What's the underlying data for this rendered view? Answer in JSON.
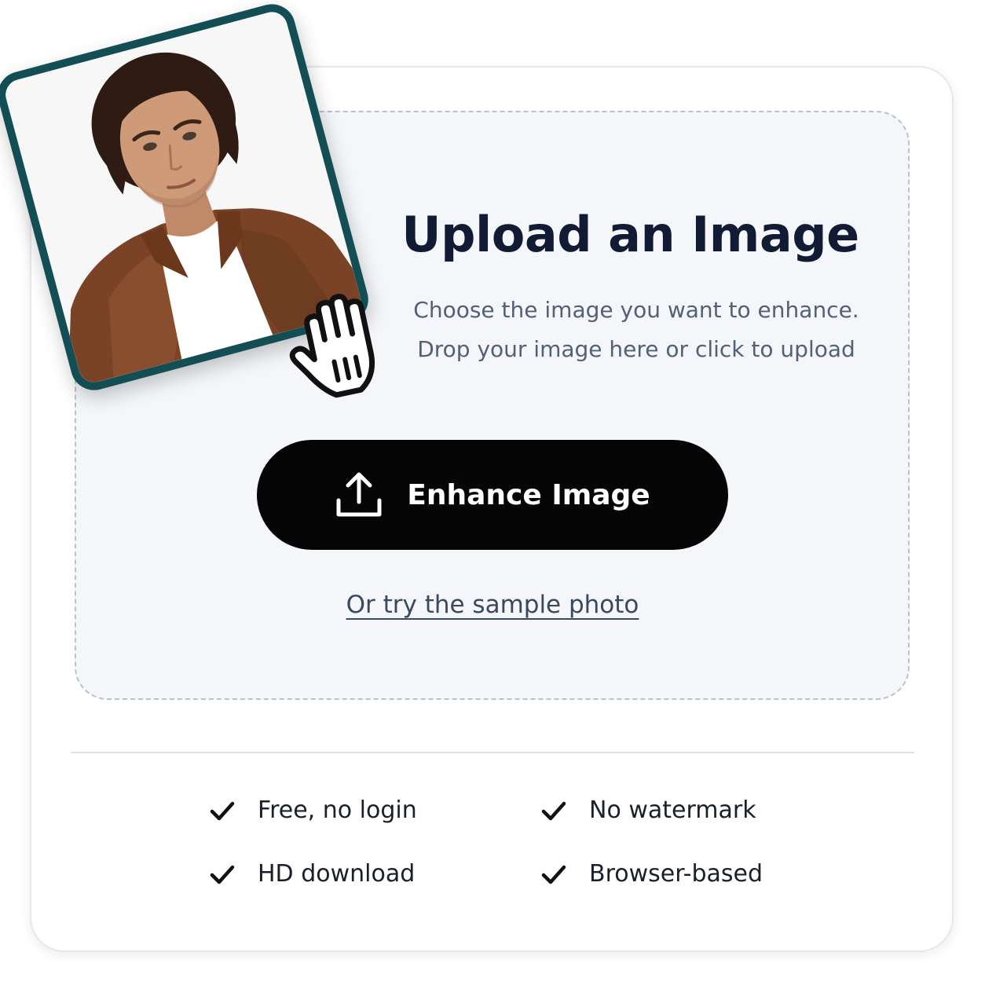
{
  "upload": {
    "title": "Upload an Image",
    "subtitle_line1": "Choose the image you want to enhance.",
    "subtitle_line2": "Drop your image here or click to upload",
    "button_label": "Enhance Image",
    "button_icon": "upload-icon",
    "sample_link": "Or try the sample photo"
  },
  "features": [
    {
      "label": "Free, no login",
      "icon": "check-icon"
    },
    {
      "label": "No watermark",
      "icon": "check-icon"
    },
    {
      "label": "HD download",
      "icon": "check-icon"
    },
    {
      "label": "Browser-based",
      "icon": "check-icon"
    }
  ],
  "decor": {
    "photo": "sample-portrait-photo",
    "cursor": "hand-pointer-cursor-icon"
  },
  "colors": {
    "button_bg": "#050505",
    "title": "#111b33",
    "subtitle": "#536076",
    "photo_frame": "#134e54",
    "dropzone_bg": "#f4f6f9",
    "dropzone_border": "#b9c2cf"
  }
}
